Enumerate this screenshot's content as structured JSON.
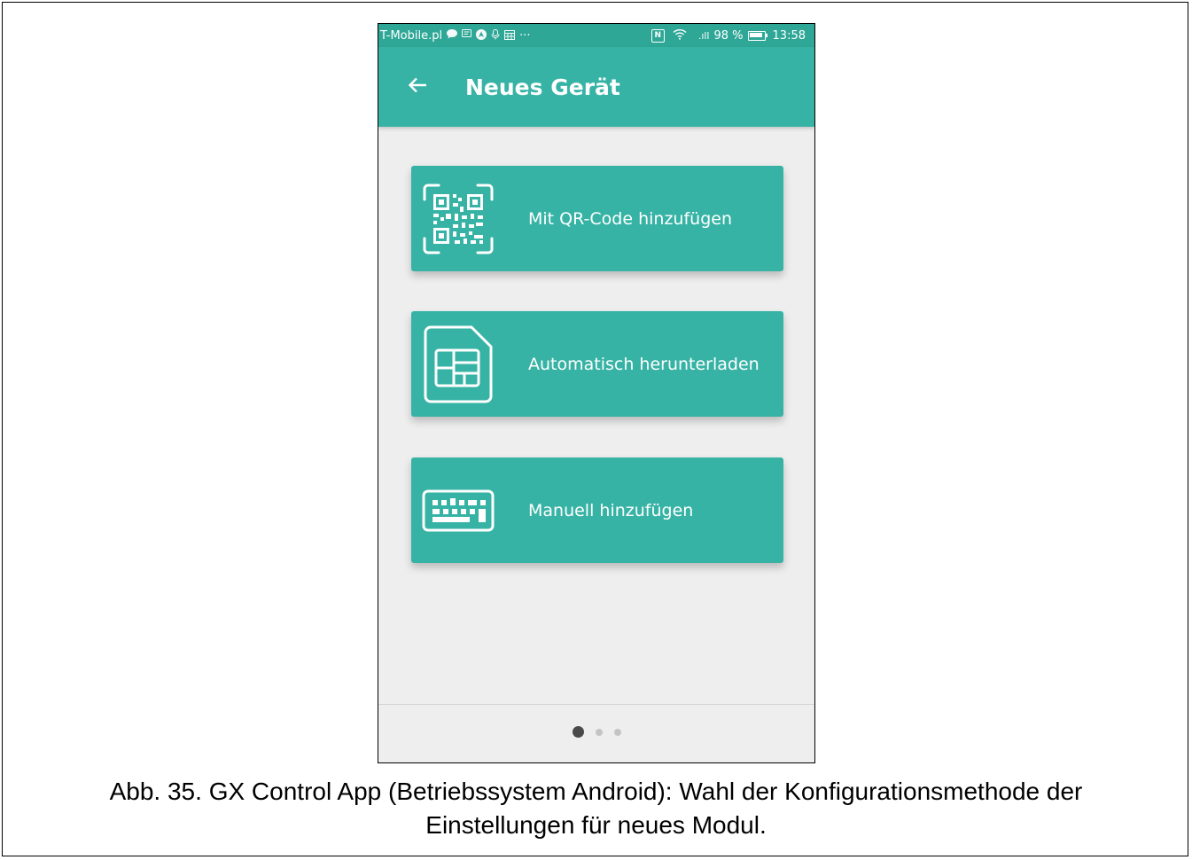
{
  "status_bar": {
    "carrier": "T-Mobile.pl",
    "notification_icons": [
      "chat-icon",
      "message-icon",
      "navigation-icon",
      "voicemail-icon",
      "calendar-icon"
    ],
    "more": "···",
    "nfc": "N",
    "signal": ".ıll",
    "battery_percent": "98 %",
    "time": "13:58"
  },
  "app_bar": {
    "back_icon": "arrow-left-icon",
    "title": "Neues Gerät"
  },
  "options": [
    {
      "icon": "qr-code-icon",
      "label": "Mit QR-Code hinzufügen"
    },
    {
      "icon": "sim-card-icon",
      "label": "Automatisch herunterladen"
    },
    {
      "icon": "keyboard-icon",
      "label": "Manuell hinzufügen"
    }
  ],
  "pager": {
    "total_pages": 3,
    "current_page": 1
  },
  "caption": {
    "line1": "Abb. 35. GX Control App (Betriebssystem Android): Wahl der Konfigurationsmethode der",
    "line2": "Einstellungen für neues Modul."
  },
  "colors": {
    "status_bar": "#2fa797",
    "app_bar": "#36b3a5",
    "card": "#36b3a5",
    "background": "#eeeeee"
  }
}
